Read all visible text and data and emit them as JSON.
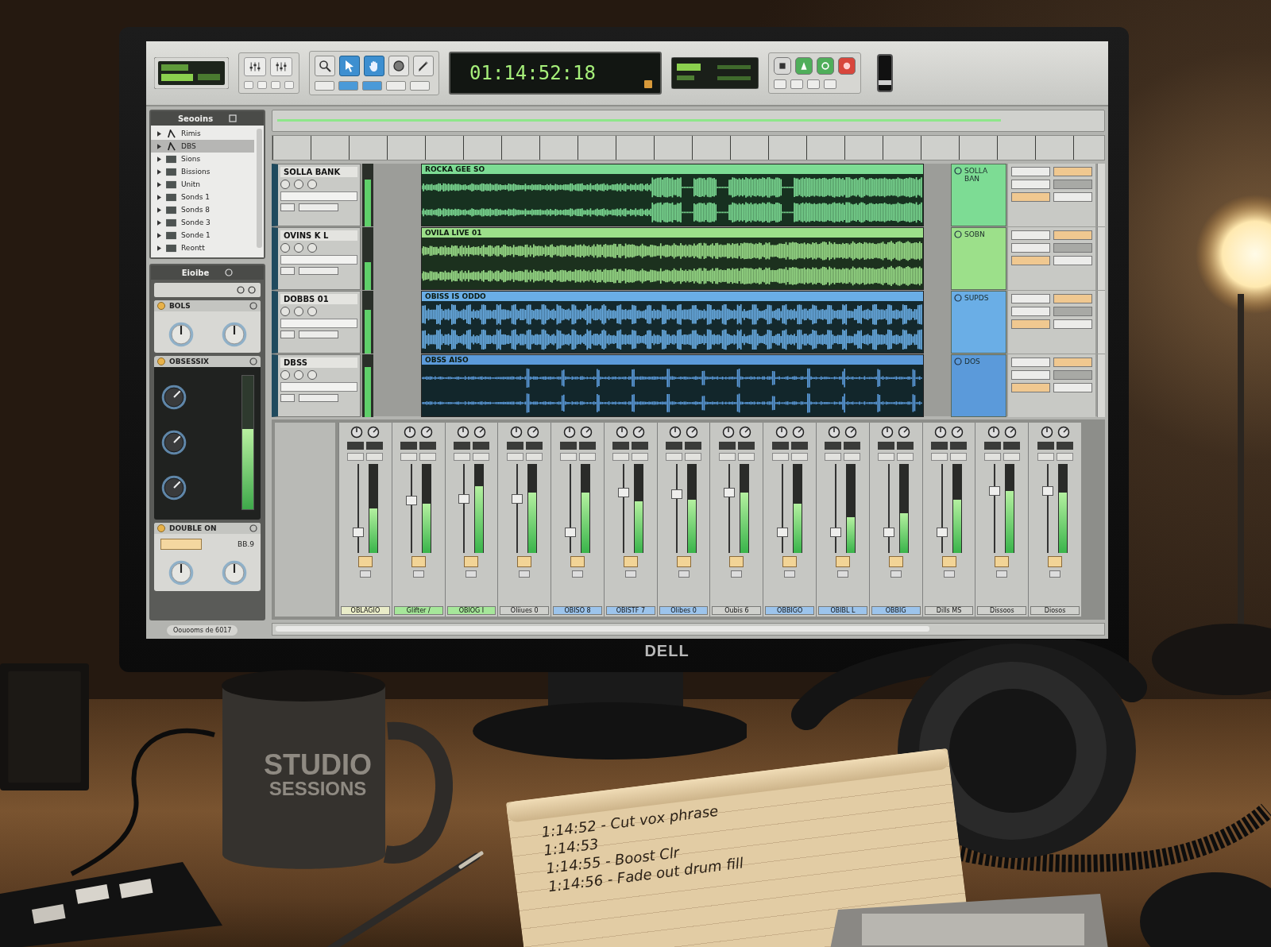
{
  "monitor": {
    "logo": "DELL"
  },
  "toolbar": {
    "tools": [
      {
        "kind": "zoom",
        "selected": false
      },
      {
        "kind": "pointer",
        "selected": true
      },
      {
        "kind": "hand",
        "selected": true
      },
      {
        "kind": "scrub",
        "selected": false
      },
      {
        "kind": "pencil",
        "selected": false
      }
    ],
    "modes": [
      {
        "selected": false
      },
      {
        "selected": true
      },
      {
        "selected": true
      },
      {
        "selected": false
      },
      {
        "selected": false
      }
    ],
    "timecode": "01:14:52:18",
    "transport": [
      {
        "kind": "stop"
      },
      {
        "kind": "play"
      },
      {
        "kind": "loop"
      },
      {
        "kind": "record"
      }
    ],
    "switch": {
      "on": false
    }
  },
  "browser": {
    "title": "Seooins",
    "items": [
      {
        "kind": "instrument",
        "label": "Rimis",
        "selected": false
      },
      {
        "kind": "instrument",
        "label": "DBS",
        "selected": true
      },
      {
        "kind": "folder",
        "label": "Sions",
        "selected": false
      },
      {
        "kind": "folder",
        "label": "Bissions",
        "selected": false
      },
      {
        "kind": "folder",
        "label": "Unitn",
        "selected": false
      },
      {
        "kind": "folder",
        "label": "Sonds 1",
        "selected": false
      },
      {
        "kind": "folder",
        "label": "Sonds 8",
        "selected": false
      },
      {
        "kind": "folder",
        "label": "Sonde 3",
        "selected": false
      },
      {
        "kind": "folder",
        "label": "Sonde 1",
        "selected": false
      },
      {
        "kind": "folder",
        "label": "Reontt",
        "selected": false
      }
    ]
  },
  "inspector": {
    "title": "Eioibe",
    "plugins": [
      {
        "kind": "eq",
        "name": "BOLS"
      },
      {
        "kind": "compressor",
        "name": "OBSESSIX",
        "meter": {
          "level": 0.6
        }
      },
      {
        "kind": "double",
        "name": "DOUBLE ON",
        "value": "BB.9"
      }
    ]
  },
  "status": "Oouooms de 6017",
  "tracks": [
    {
      "name": "SOLLA BANK",
      "color": "#7ddc94",
      "region": "ROCKA GEE SO",
      "label": "SOLLA BAN",
      "meter": {
        "level": 0.75
      }
    },
    {
      "name": "OVINS K L",
      "color": "#9ce08a",
      "region": "OVILA LIVE 01",
      "label": "SOBN",
      "meter": {
        "level": 0.45
      }
    },
    {
      "name": "DOBBS 01",
      "color": "#6aaee6",
      "region": "OBISS IS ODDO",
      "label": "SUPDS",
      "meter": {
        "level": 0.7
      }
    },
    {
      "name": "DBSS",
      "color": "#5b9ada",
      "region": "OBSS AISO",
      "label": "DOS",
      "meter": {
        "level": 0.8
      }
    }
  ],
  "mixer": {
    "channels": [
      {
        "name": "OBLAGIO",
        "color": "#e9ecc8",
        "fader": {
          "level": 0.2
        },
        "meter": {
          "level": 0.5
        }
      },
      {
        "name": "Glifter /",
        "color": "#a6e79a",
        "fader": {
          "level": 0.6
        },
        "meter": {
          "level": 0.55
        }
      },
      {
        "name": "OBIOG I",
        "color": "#a6e79a",
        "fader": {
          "level": 0.62
        },
        "meter": {
          "level": 0.75
        }
      },
      {
        "name": "Oliiues 0",
        "color": "#cfd0cc",
        "fader": {
          "level": 0.62
        },
        "meter": {
          "level": 0.68
        }
      },
      {
        "name": "OBISO 8",
        "color": "#9cc4ec",
        "fader": {
          "level": 0.2
        },
        "meter": {
          "level": 0.68
        }
      },
      {
        "name": "OBISTF 7",
        "color": "#9cc4ec",
        "fader": {
          "level": 0.7
        },
        "meter": {
          "level": 0.58
        }
      },
      {
        "name": "Olibes 0",
        "color": "#9cc4ec",
        "fader": {
          "level": 0.68
        },
        "meter": {
          "level": 0.6
        }
      },
      {
        "name": "Oubis 6",
        "color": "#cfd0cc",
        "fader": {
          "level": 0.7
        },
        "meter": {
          "level": 0.68
        }
      },
      {
        "name": "OBBIGO",
        "color": "#9cc4ec",
        "fader": {
          "level": 0.2
        },
        "meter": {
          "level": 0.55
        }
      },
      {
        "name": "OBIBL L",
        "color": "#9cc4ec",
        "fader": {
          "level": 0.2
        },
        "meter": {
          "level": 0.4
        }
      },
      {
        "name": "OBBIG",
        "color": "#9cc4ec",
        "fader": {
          "level": 0.2
        },
        "meter": {
          "level": 0.45
        }
      },
      {
        "name": "Dills MS",
        "color": "#cfd0cc",
        "fader": {
          "level": 0.2
        },
        "meter": {
          "level": 0.6
        }
      },
      {
        "name": "Dissoos",
        "color": "#cfd0cc",
        "fader": {
          "level": 0.72
        },
        "meter": {
          "level": 0.7
        }
      },
      {
        "name": "Diosos",
        "color": "#cfd0cc",
        "fader": {
          "level": 0.72
        },
        "meter": {
          "level": 0.68
        }
      }
    ]
  },
  "mug": {
    "print": [
      "STUDIO",
      "SESSIONS"
    ]
  },
  "notepad": {
    "lines": [
      "1:14:52 - Cut vox phrase",
      "1:14:53",
      "1:14:55 - Boost Clr",
      "1:14:56 - Fade out drum fill"
    ]
  }
}
